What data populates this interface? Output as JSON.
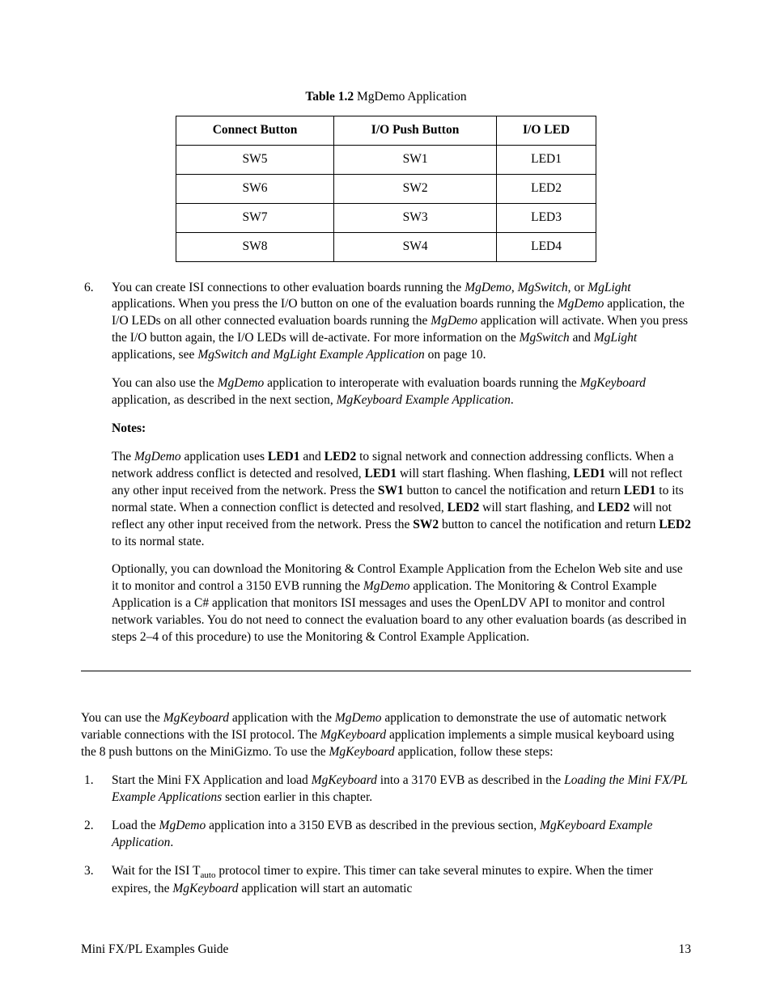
{
  "table_caption_prefix": "Table 1.2",
  "table_caption_rest": " MgDemo Application",
  "table": {
    "headers": [
      "Connect Button",
      "I/O Push Button",
      "I/O LED"
    ],
    "rows": [
      [
        "SW5",
        "SW1",
        "LED1"
      ],
      [
        "SW6",
        "SW2",
        "LED2"
      ],
      [
        "SW7",
        "SW3",
        "LED3"
      ],
      [
        "SW8",
        "SW4",
        "LED4"
      ]
    ]
  },
  "item6_num": "6.",
  "item6_p1": {
    "t1": "You can create ISI connections to other evaluation boards running the ",
    "i1": "MgDemo",
    "t2": ", ",
    "i2": "MgSwitch",
    "t3": ", or ",
    "i3": "MgLight",
    "t4": " applications.  When you press the I/O button on one of the evaluation boards running the ",
    "i4": "MgDemo",
    "t5": " application, the I/O LEDs on all other connected evaluation boards running the ",
    "i5": "MgDemo",
    "t6": " application will activate.  When you press the I/O button again, the I/O LEDs will de-activate.  For more information on the ",
    "i6": "MgSwitch",
    "t7": " and ",
    "i7": "MgLight",
    "t8": " applications, see ",
    "i8": "MgSwitch and MgLight Example Application",
    "t9": " on page 10."
  },
  "item6_p2": {
    "t1": "You can also use the ",
    "i1": "MgDemo",
    "t2": " application to interoperate with evaluation boards running the ",
    "i2": "MgKeyboard",
    "t3": " application, as described in the next section, ",
    "i3": "MgKeyboard Example Application",
    "t4": "."
  },
  "notes_label": "Notes:",
  "notes_p1": {
    "t1": "The ",
    "i1": "MgDemo",
    "t2": " application uses ",
    "b1": "LED1",
    "t3": " and ",
    "b2": "LED2",
    "t4": " to signal network and connection addressing conflicts.  When a network address conflict is detected and resolved, ",
    "b3": "LED1",
    "t5": " will start flashing.  When flashing, ",
    "b4": "LED1",
    "t6": " will not reflect any other input received from the network.  Press the ",
    "b5": "SW1",
    "t7": " button to cancel the notification and return ",
    "b6": "LED1",
    "t8": " to its normal state.  When a connection conflict is detected and resolved, ",
    "b7": "LED2",
    "t9": " will start flashing, and ",
    "b8": "LED2",
    "t10": " will not reflect any other input received from the network.  Press the ",
    "b9": "SW2",
    "t11": " button to cancel the notification and return ",
    "b10": "LED2",
    "t12": " to its normal state."
  },
  "notes_p2": {
    "t1": "Optionally, you can download the Monitoring & Control Example Application from the Echelon Web site and use it to monitor and control a 3150 EVB running the ",
    "i1": "MgDemo",
    "t2": " application.  The Monitoring & Control Example Application is a C# application that monitors ISI messages and uses the OpenLDV API to monitor and control network variables.  You do not need to connect the evaluation board to any other evaluation boards (as described in steps 2–4 of this procedure) to use the Monitoring & Control Example Application."
  },
  "section2_p1": {
    "t1": "You can use the ",
    "i1": "MgKeyboard",
    "t2": " application with the ",
    "i2": "MgDemo",
    "t3": " application to demonstrate the use of automatic network variable connections with the ISI protocol.  The ",
    "i3": "MgKeyboard",
    "t4": " application implements a simple musical keyboard using the 8 push buttons on the MiniGizmo.  To use the ",
    "i4": "MgKeyboard",
    "t5": " application, follow these steps:"
  },
  "step1_num": "1.",
  "step1": {
    "t1": "Start the Mini FX Application and load ",
    "i1": "MgKeyboard",
    "t2": " into a 3170 EVB as described in the ",
    "i2": "Loading the Mini FX/PL Example Applications",
    "t3": " section earlier in this chapter."
  },
  "step2_num": "2.",
  "step2": {
    "t1": "Load the ",
    "i1": "MgDemo",
    "t2": " application into a 3150 EVB as described in the previous section, ",
    "i2": "MgKeyboard Example Application",
    "t3": "."
  },
  "step3_num": "3.",
  "step3": {
    "t1": "Wait for the ISI T",
    "sub1": "auto",
    "t2": " protocol timer to expire. This timer can take several minutes to expire.  When the timer expires, the ",
    "i1": "MgKeyboard",
    "t3": " application will start an automatic"
  },
  "footer_left": "Mini FX/PL Examples Guide",
  "footer_right": "13"
}
